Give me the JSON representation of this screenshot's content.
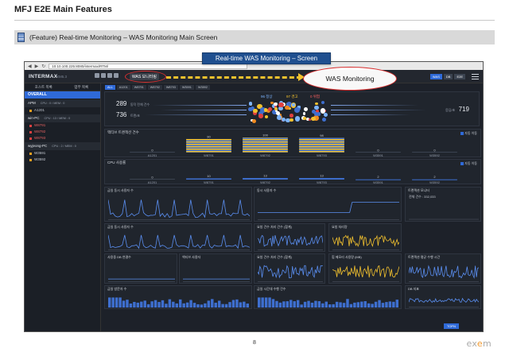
{
  "page": {
    "header": "MFJ E2E Main Features",
    "section_title": "(Feature) Real-time Monitoring – WAS Monitoring Main Screen",
    "caption": "Real-time WAS Monitoring – Screen",
    "page_number": "8",
    "brand": "exem"
  },
  "screenshot": {
    "browser_url": "10.10.100.225:8080/intermax/RTM/",
    "app_logo": "INTERMAX",
    "app_version": "XM5.3",
    "tab_label": "WAS 모니터링",
    "callout_label": "WAS Monitoring",
    "right_buttons": [
      "WAS",
      "DB",
      "E2E"
    ],
    "sidebar": {
      "tabs": [
        "호스트 목록",
        "업무 목록"
      ],
      "overall": "OVERALL",
      "groups": [
        {
          "name": "APM",
          "meta": "CPU : 0 / MEM : 0",
          "items": [
            {
              "label": "A1201",
              "color": "#f0a020"
            }
          ]
        },
        {
          "name": "win-PC",
          "meta": "CPU : 13 / MEM : 0",
          "items": [
            {
              "label": "W8791",
              "color": "#e04040"
            },
            {
              "label": "W8792",
              "color": "#e04040"
            },
            {
              "label": "W8793",
              "color": "#e04040"
            }
          ]
        },
        {
          "name": "wyjeong-PC",
          "meta": "CPU : 2 / MEM : 0",
          "items": [
            {
              "label": "W3591",
              "color": "#f0a020"
            },
            {
              "label": "W3592",
              "color": "#f0a020"
            }
          ]
        }
      ]
    },
    "filters": [
      "ALL",
      "A1201",
      "W8791",
      "W8792",
      "W8793",
      "W3591",
      "W3592"
    ],
    "flow": {
      "left_count": "289",
      "left_count_label": "동작 전체 건수",
      "left_rate": "736",
      "left_rate_label": "트랜/초",
      "right_rate": "719",
      "right_rate_label": "응답/초",
      "normal_count": "96",
      "normal_label": "정상",
      "warning_count": "97",
      "warning_label": "경고",
      "critical_count": "0",
      "critical_label": "위험"
    },
    "panels": {
      "active": {
        "title": "액티브 트랜잭션 건수",
        "check": "자동 이동"
      },
      "cpu": {
        "title": "CPU 사용률",
        "check": "자동 이동"
      },
      "mini_titles": [
        "금일 동시 사용자 수",
        "동시 사용자 수",
        "트랜잭션 모니터",
        "금일 동시 사용자 수",
        "요청 건수 처리 건수 (합계)",
        "요청 처리량",
        "사용중 DB 연결수",
        "액티브 사용자",
        "요청 건수 처리 건수 (합계)",
        "힙 메모리 사용량 (MB)",
        "트랜잭션 평균 수행 시간",
        "금일 방문자 수",
        "금일 시간대 수행 건수",
        "DB 지표"
      ],
      "monitor_stat": "전체 건수 : 332,033",
      "bottom_button": "TOPN"
    }
  },
  "chart_data": [
    {
      "type": "bar",
      "title": "액티브 트랜잭션 건수",
      "categories": [
        "A1201",
        "W8791",
        "W8792",
        "W8793",
        "W3591",
        "W3592"
      ],
      "values": [
        0,
        90,
        100,
        98,
        0,
        0
      ],
      "ylim": [
        0,
        100
      ]
    },
    {
      "type": "bar",
      "title": "CPU 사용률",
      "categories": [
        "A1201",
        "W8791",
        "W8792",
        "W8793",
        "W3591",
        "W3592"
      ],
      "values": [
        0,
        10,
        13,
        13,
        2,
        2
      ],
      "ylim": [
        0,
        100
      ]
    }
  ]
}
